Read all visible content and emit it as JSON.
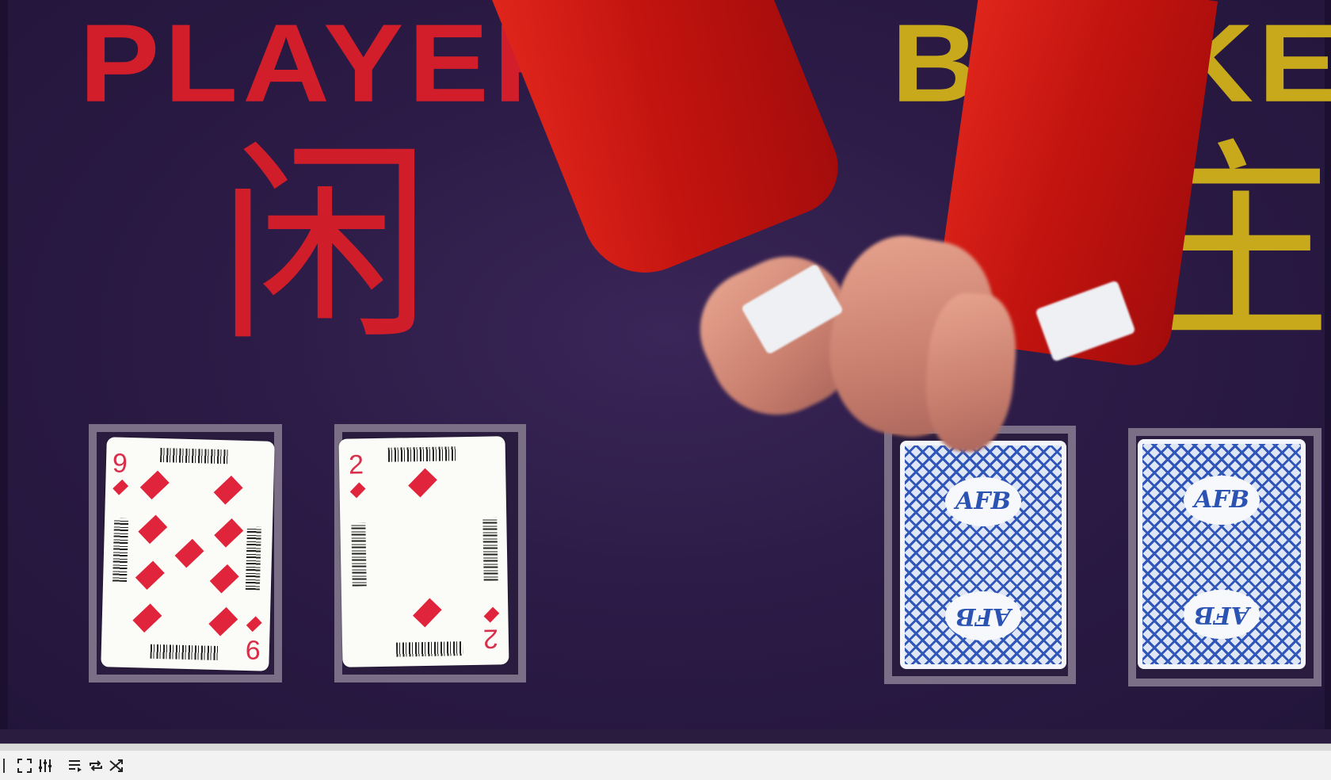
{
  "table": {
    "player_label": "PLAYER",
    "player_label_cn": "闲",
    "banker_label": "BANKER",
    "banker_label_cn": "庄"
  },
  "cards": {
    "player": [
      {
        "rank": "9",
        "suit": "diamonds",
        "face_up": true
      },
      {
        "rank": "2",
        "suit": "diamonds",
        "face_up": true
      }
    ],
    "banker": [
      {
        "face_up": false,
        "back_logo": "AFB"
      },
      {
        "face_up": false,
        "back_logo": "AFB"
      }
    ]
  },
  "colors": {
    "table": "#2c1b46",
    "player_text": "#d21e2a",
    "banker_text": "#c9a91c",
    "diamond": "#e0243c",
    "card_back": "#2f56b8"
  },
  "controls": {
    "progress": 0.0,
    "buttons": [
      {
        "name": "fullscreen",
        "icon": "fullscreen-icon"
      },
      {
        "name": "equalizer",
        "icon": "sliders-icon"
      },
      {
        "name": "playlist",
        "icon": "playlist-icon"
      },
      {
        "name": "loop",
        "icon": "repeat-icon"
      },
      {
        "name": "shuffle",
        "icon": "shuffle-icon"
      }
    ]
  }
}
